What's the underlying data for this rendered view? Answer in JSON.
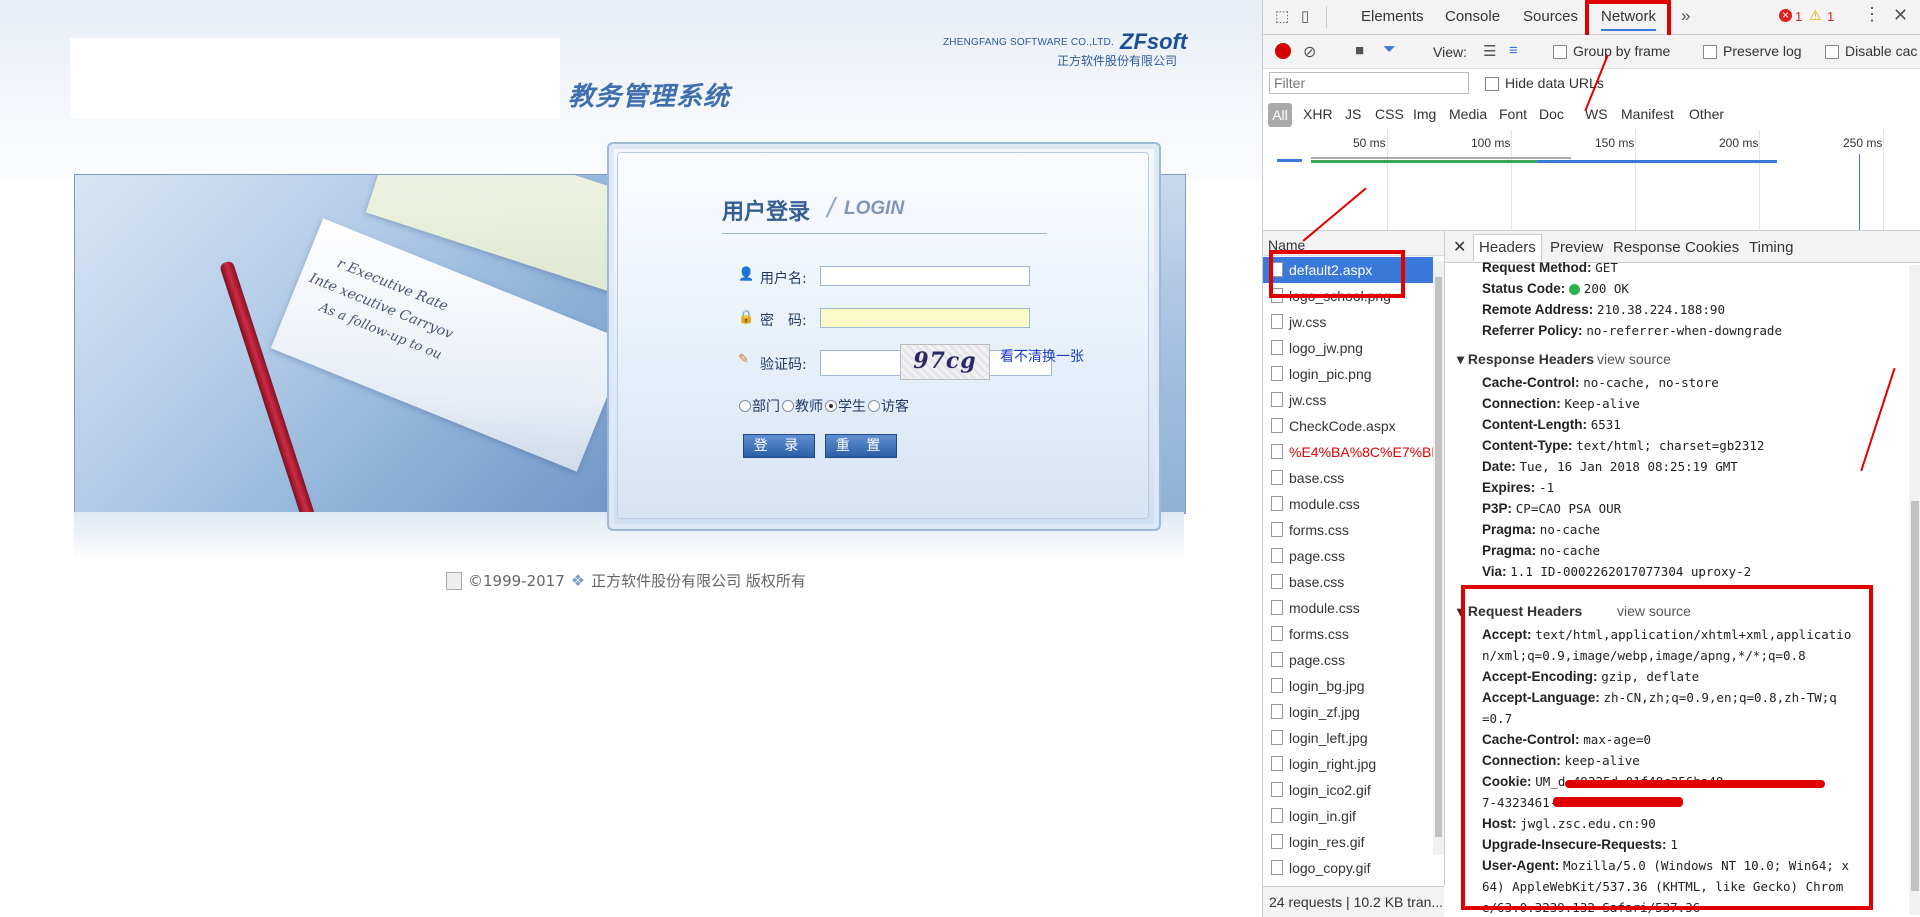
{
  "webpage": {
    "system_title": "教务管理系统",
    "company_en": "ZHENGFANG SOFTWARE CO.,LTD.",
    "company_logo": "ZFsoft",
    "company_cn": "正方软件股份有限公司",
    "login_title": "用户登录",
    "login_subtitle": "LOGIN",
    "username_label": "用户名:",
    "password_label": "密　码:",
    "captcha_label": "验证码:",
    "captcha_text": "97cg",
    "captcha_refresh": "看不清换一张",
    "roles": [
      {
        "label": "部门",
        "checked": false
      },
      {
        "label": "教师",
        "checked": false
      },
      {
        "label": "学生",
        "checked": true
      },
      {
        "label": "访客",
        "checked": false
      }
    ],
    "login_button": "登 录",
    "reset_button": "重 置",
    "footer_text": "©1999-2017",
    "footer_company": "正方软件股份有限公司 版权所有",
    "banner_text_1": "r Executive Rate",
    "banner_text_2": "Inte xecutive Carryov",
    "banner_text_3": "As a follow-up to ou"
  },
  "devtools": {
    "tabs": [
      "Elements",
      "Console",
      "Sources",
      "Network"
    ],
    "active_tab": "Network",
    "more": "»",
    "errors": "1",
    "warnings": "1",
    "view_label": "View:",
    "group_by_frame": "Group by frame",
    "preserve_log": "Preserve log",
    "disable_cache": "Disable cac",
    "filter_placeholder": "Filter",
    "hide_data_urls": "Hide data URLs",
    "type_filters": [
      "All",
      "XHR",
      "JS",
      "CSS",
      "Img",
      "Media",
      "Font",
      "Doc",
      "WS",
      "Manifest",
      "Other"
    ],
    "timeline_labels": [
      "50 ms",
      "100 ms",
      "150 ms",
      "200 ms",
      "250 ms"
    ],
    "name_header": "Name",
    "requests": [
      "default2.aspx",
      "logo_school.png",
      "jw.css",
      "logo_jw.png",
      "login_pic.png",
      "jw.css",
      "CheckCode.aspx",
      "%E4%BA%8C%E7%BB",
      "base.css",
      "module.css",
      "forms.css",
      "page.css",
      "base.css",
      "module.css",
      "forms.css",
      "page.css",
      "login_bg.jpg",
      "login_zf.jpg",
      "login_left.jpg",
      "login_right.jpg",
      "login_ico2.gif",
      "login_in.gif",
      "login_res.gif",
      "logo_copy.gif"
    ],
    "selected_request": "default2.aspx",
    "error_request": "%E4%BA%8C%E7%BB",
    "status_bar": "24 requests  |  10.2 KB tran...",
    "detail_tabs": [
      "Headers",
      "Preview",
      "Response",
      "Cookies",
      "Timing"
    ],
    "active_detail_tab": "Headers",
    "general": [
      {
        "k": "Request Method:",
        "v": "GET"
      },
      {
        "k": "Status Code:",
        "v": "200 OK"
      },
      {
        "k": "Remote Address:",
        "v": "210.38.224.188:90"
      },
      {
        "k": "Referrer Policy:",
        "v": "no-referrer-when-downgrade"
      }
    ],
    "response_headers_title": "Response Headers",
    "request_headers_title": "Request Headers",
    "view_source": "view source",
    "response_headers": [
      {
        "k": "Cache-Control:",
        "v": "no-cache, no-store"
      },
      {
        "k": "Connection:",
        "v": "Keep-alive"
      },
      {
        "k": "Content-Length:",
        "v": "6531"
      },
      {
        "k": "Content-Type:",
        "v": "text/html; charset=gb2312"
      },
      {
        "k": "Date:",
        "v": "Tue, 16 Jan 2018 08:25:19 GMT"
      },
      {
        "k": "Expires:",
        "v": "-1"
      },
      {
        "k": "P3P:",
        "v": "CP=CAO PSA OUR"
      },
      {
        "k": "Pragma:",
        "v": "no-cache"
      },
      {
        "k": "Pragma:",
        "v": "no-cache"
      },
      {
        "k": "Via:",
        "v": "1.1 ID-0002262017077304 uproxy-2"
      }
    ],
    "request_headers": {
      "accept_k": "Accept:",
      "accept_v1": "text/html,application/xhtml+xml,applicatio",
      "accept_v2": "n/xml;q=0.9,image/webp,image/apng,*/*;q=0.8",
      "encoding_k": "Accept-Encoding:",
      "encoding_v": "gzip, deflate",
      "language_k": "Accept-Language:",
      "language_v1": "zh-CN,zh;q=0.9,en;q=0.8,zh-TW;q",
      "language_v2": "=0.7",
      "cache_k": "Cache-Control:",
      "cache_v": "max-age=0",
      "conn_k": "Connection:",
      "conn_v": "keep-alive",
      "cookie_k": "Cookie:",
      "cookie_v1": "UM_d                    49225d-01f48c356ba48",
      "cookie_v2": "7-4323461-             935c7",
      "host_k": "Host:",
      "host_v": "jwgl.zsc.edu.cn:90",
      "upgrade_k": "Upgrade-Insecure-Requests:",
      "upgrade_v": "1",
      "ua_k": "User-Agent:",
      "ua_v1": "Mozilla/5.0 (Windows NT 10.0; Win64; x",
      "ua_v2": "64) AppleWebKit/537.36 (KHTML, like Gecko) Chrom",
      "ua_v3": "e/63.0.3239.132 Safari/537.36"
    }
  }
}
